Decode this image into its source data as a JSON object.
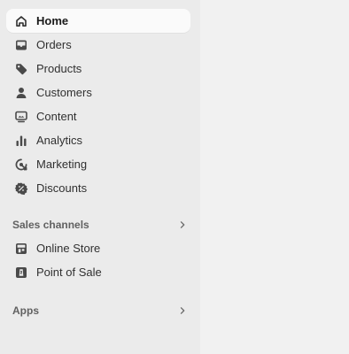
{
  "nav": {
    "items": [
      {
        "label": "Home",
        "icon": "home-icon"
      },
      {
        "label": "Orders",
        "icon": "inbox-icon"
      },
      {
        "label": "Products",
        "icon": "tag-icon"
      },
      {
        "label": "Customers",
        "icon": "person-icon"
      },
      {
        "label": "Content",
        "icon": "content-icon"
      },
      {
        "label": "Analytics",
        "icon": "bar-chart-icon"
      },
      {
        "label": "Marketing",
        "icon": "target-icon"
      },
      {
        "label": "Discounts",
        "icon": "discount-badge-icon"
      }
    ],
    "active_index": 0
  },
  "sales_channels": {
    "title": "Sales channels",
    "items": [
      {
        "label": "Online Store",
        "icon": "storefront-icon"
      },
      {
        "label": "Point of Sale",
        "icon": "pos-icon"
      }
    ]
  },
  "apps": {
    "title": "Apps"
  },
  "colors": {
    "sidebar_bg": "#ebebeb",
    "main_bg": "#f1f1f1",
    "active_item_bg": "#fafafa",
    "text": "#303030",
    "section_title": "#616161"
  }
}
